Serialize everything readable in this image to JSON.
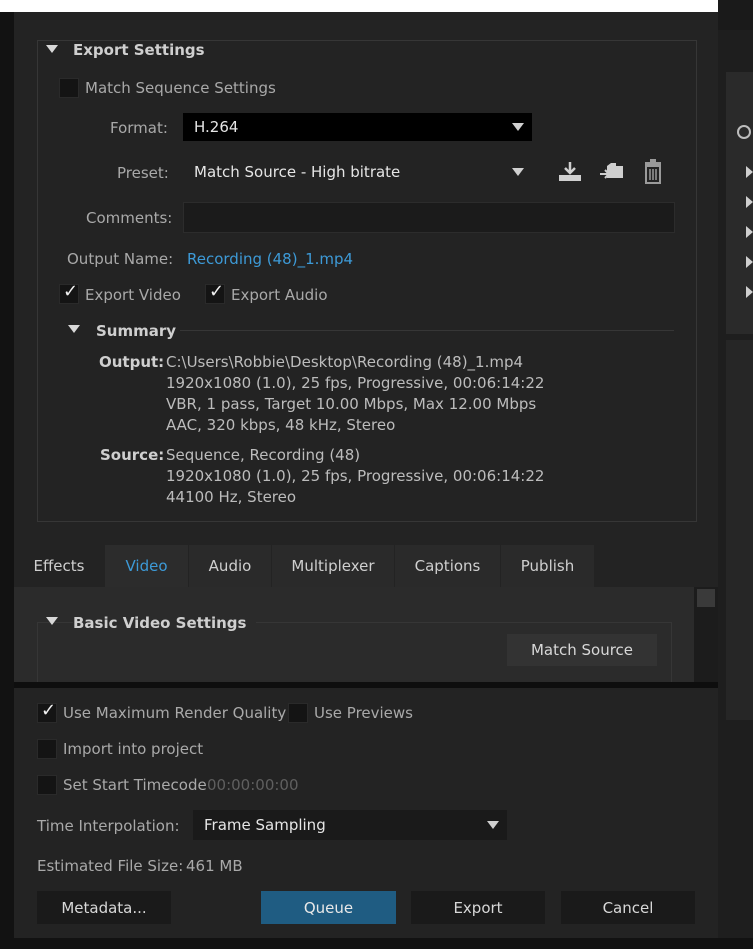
{
  "export_settings": {
    "title": "Export Settings",
    "match_sequence_label": "Match Sequence Settings",
    "format_label": "Format:",
    "format_value": "H.264",
    "preset_label": "Preset:",
    "preset_value": "Match Source - High bitrate",
    "comments_label": "Comments:",
    "comments_value": "",
    "output_name_label": "Output Name:",
    "output_name_value": "Recording (48)_1.mp4",
    "export_video_label": "Export Video",
    "export_audio_label": "Export Audio",
    "export_video_checked": true,
    "export_audio_checked": true
  },
  "summary": {
    "title": "Summary",
    "output_label": "Output:",
    "output_lines": [
      "C:\\Users\\Robbie\\Desktop\\Recording (48)_1.mp4",
      "1920x1080 (1.0), 25 fps, Progressive, 00:06:14:22",
      "VBR, 1 pass, Target 10.00 Mbps, Max 12.00 Mbps",
      "AAC, 320 kbps, 48 kHz, Stereo"
    ],
    "source_label": "Source:",
    "source_lines": [
      "Sequence, Recording (48)",
      "1920x1080 (1.0), 25 fps, Progressive, 00:06:14:22",
      "44100 Hz, Stereo"
    ]
  },
  "tabs": {
    "effects": "Effects",
    "video": "Video",
    "audio": "Audio",
    "multiplexer": "Multiplexer",
    "captions": "Captions",
    "publish": "Publish",
    "active": "Video"
  },
  "basic_video": {
    "title": "Basic Video Settings",
    "match_source_button": "Match Source"
  },
  "bottom": {
    "max_render_label": "Use Maximum Render Quality",
    "max_render_checked": true,
    "use_previews_label": "Use Previews",
    "import_label": "Import into project",
    "start_timecode_label": "Set Start Timecode",
    "start_timecode_value": "00:00:00:00",
    "time_interp_label": "Time Interpolation:",
    "time_interp_value": "Frame Sampling",
    "file_size_label": "Estimated File Size:",
    "file_size_value": "461 MB",
    "metadata_button": "Metadata...",
    "queue_button": "Queue",
    "export_button": "Export",
    "cancel_button": "Cancel"
  },
  "colors": {
    "link": "#3d9ad7",
    "queue_bg": "#1f5c82",
    "panel_bg": "#232323"
  }
}
